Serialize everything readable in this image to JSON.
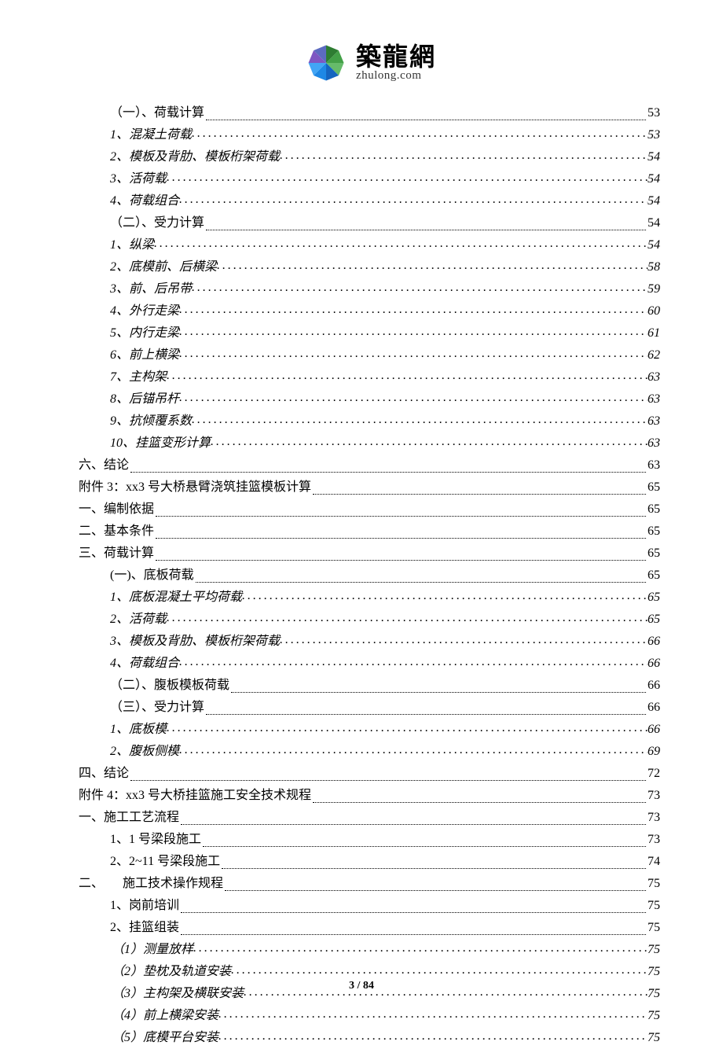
{
  "logo": {
    "title": "築龍網",
    "subtitle": "zhulong.com"
  },
  "toc": [
    {
      "label": "（一）、荷载计算",
      "page": "53",
      "type": "plain",
      "indent": 1
    },
    {
      "label": "1、混凝土荷载",
      "page": "53",
      "type": "italic",
      "indent": 1
    },
    {
      "label": "2、模板及背肋、模板桁架荷载",
      "page": "54",
      "type": "italic",
      "indent": 1
    },
    {
      "label": "3、活荷载",
      "page": "54",
      "type": "italic",
      "indent": 1
    },
    {
      "label": "4、荷载组合",
      "page": "54",
      "type": "italic",
      "indent": 1
    },
    {
      "label": "（二）、受力计算",
      "page": "54",
      "type": "plain",
      "indent": 1
    },
    {
      "label": "1、纵梁",
      "page": "54",
      "type": "italic",
      "indent": 1
    },
    {
      "label": "2、底模前、后横梁",
      "page": "58",
      "type": "italic",
      "indent": 1
    },
    {
      "label": "3、前、后吊带",
      "page": "59",
      "type": "italic",
      "indent": 1
    },
    {
      "label": "4、外行走梁",
      "page": "60",
      "type": "italic",
      "indent": 1
    },
    {
      "label": "5、内行走梁",
      "page": "61",
      "type": "italic",
      "indent": 1
    },
    {
      "label": "6、前上横梁",
      "page": "62",
      "type": "italic",
      "indent": 1
    },
    {
      "label": "7、主构架",
      "page": "63",
      "type": "italic",
      "indent": 1
    },
    {
      "label": "8、后锚吊杆",
      "page": "63",
      "type": "italic",
      "indent": 1
    },
    {
      "label": "9、抗倾覆系数",
      "page": "63",
      "type": "italic",
      "indent": 1
    },
    {
      "label": "10、挂篮变形计算",
      "page": "63",
      "type": "italic",
      "indent": 1
    },
    {
      "label": "六、结论",
      "page": "63",
      "type": "plain",
      "indent": 0
    },
    {
      "label": "附件 3：xx3 号大桥悬臂浇筑挂篮模板计算",
      "page": "65",
      "type": "plain",
      "indent": 0
    },
    {
      "label": "一、编制依据",
      "page": "65",
      "type": "plain",
      "indent": 0
    },
    {
      "label": "二、基本条件",
      "page": "65",
      "type": "plain",
      "indent": 0
    },
    {
      "label": "三、荷载计算",
      "page": "65",
      "type": "plain",
      "indent": 0
    },
    {
      "label": "(一)、底板荷载",
      "page": "65",
      "type": "plain",
      "indent": 1
    },
    {
      "label": "1、底板混凝土平均荷载",
      "page": "65",
      "type": "italic",
      "indent": 1
    },
    {
      "label": "2、活荷载",
      "page": "65",
      "type": "italic",
      "indent": 1
    },
    {
      "label": "3、模板及背肋、模板桁架荷载",
      "page": "66",
      "type": "italic",
      "indent": 1
    },
    {
      "label": "4、荷载组合",
      "page": "66",
      "type": "italic",
      "indent": 1
    },
    {
      "label": "（二）、腹板模板荷载",
      "page": "66",
      "type": "plain",
      "indent": 1
    },
    {
      "label": "（三）、受力计算",
      "page": "66",
      "type": "plain",
      "indent": 1
    },
    {
      "label": "1、底板模",
      "page": "66",
      "type": "italic",
      "indent": 1
    },
    {
      "label": "2、腹板侧模",
      "page": "69",
      "type": "italic",
      "indent": 1
    },
    {
      "label": "四、结论",
      "page": "72",
      "type": "plain",
      "indent": 0
    },
    {
      "label": "附件 4：xx3 号大桥挂篮施工安全技术规程",
      "page": "73",
      "type": "plain",
      "indent": 0
    },
    {
      "label": "一、施工工艺流程",
      "page": "73",
      "type": "plain",
      "indent": 0
    },
    {
      "label": "1、1 号梁段施工",
      "page": "73",
      "type": "plain",
      "indent": 1
    },
    {
      "label": "2、2~11 号梁段施工",
      "page": "74",
      "type": "plain",
      "indent": 1
    },
    {
      "label": "二、　　施工技术操作规程",
      "page": "75",
      "type": "plain",
      "indent": 0
    },
    {
      "label": "1、岗前培训",
      "page": "75",
      "type": "plain",
      "indent": 1
    },
    {
      "label": "2、挂篮组装",
      "page": "75",
      "type": "plain",
      "indent": 1
    },
    {
      "label": "（1）测量放样",
      "page": "75",
      "type": "italic",
      "indent": 2
    },
    {
      "label": "（2）垫枕及轨道安装",
      "page": "75",
      "type": "italic",
      "indent": 2
    },
    {
      "label": "（3）主构架及横联安装",
      "page": "75",
      "type": "italic",
      "indent": 2
    },
    {
      "label": "（4）前上横梁安装",
      "page": "75",
      "type": "italic",
      "indent": 2
    },
    {
      "label": "（5）底模平台安装",
      "page": "75",
      "type": "italic",
      "indent": 2
    }
  ],
  "footer": "3 / 84"
}
